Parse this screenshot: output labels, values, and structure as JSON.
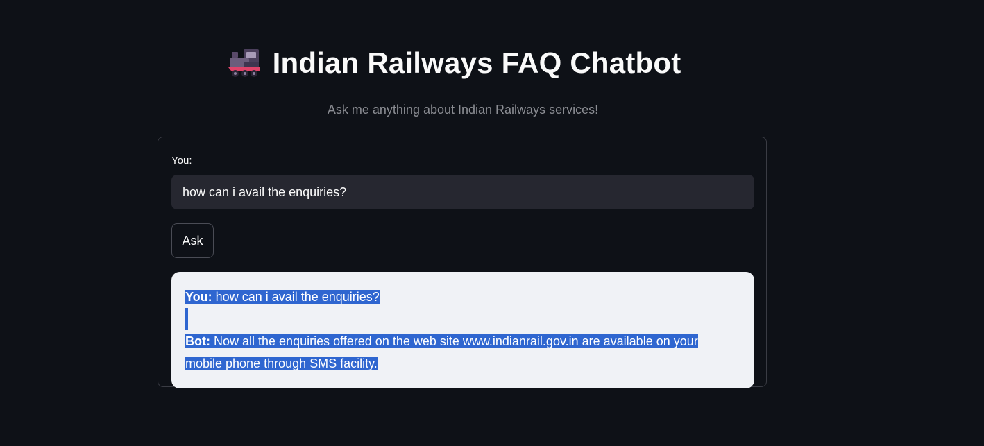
{
  "header": {
    "icon": "steam-locomotive-icon",
    "title": "Indian Railways FAQ Chatbot",
    "subtitle": "Ask me anything about Indian Railways services!"
  },
  "form": {
    "input_label": "You:",
    "input_value": "how can i avail the enquiries?",
    "ask_label": "Ask"
  },
  "chat": {
    "user_prefix": "You:",
    "user_text": "how can i avail the enquiries?",
    "bot_prefix": "Bot:",
    "bot_text_line1": "Now all the enquiries offered on the web site www.indianrail.gov.in are available on your",
    "bot_text_line2": "mobile phone through SMS facility."
  },
  "colors": {
    "background": "#0e1117",
    "selection": "#2f66d0",
    "card": "#f0f2f6",
    "input_bg": "#262730"
  }
}
